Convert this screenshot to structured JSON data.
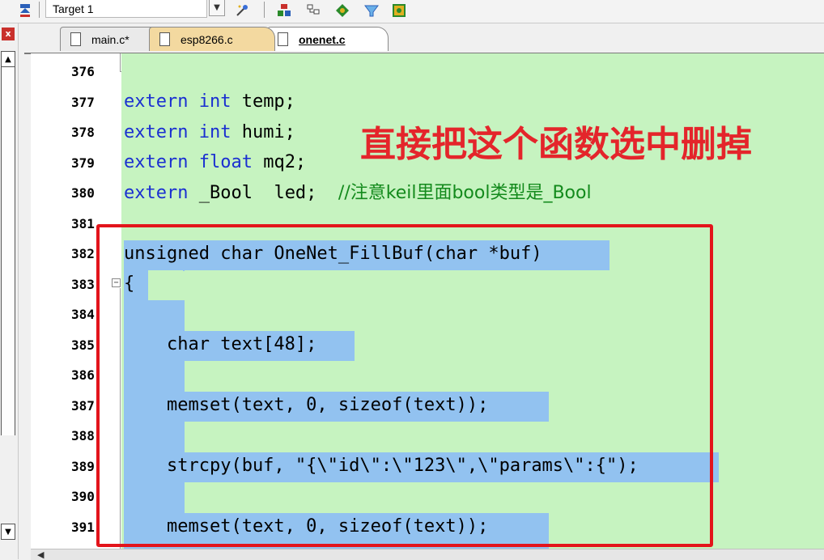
{
  "toolbar": {
    "target_label": "Target 1"
  },
  "tabs": [
    {
      "label": "main.c*",
      "active": false
    },
    {
      "label": "esp8266.c",
      "active": false
    },
    {
      "label": "onenet.c",
      "active": true
    }
  ],
  "editor": {
    "line_numbers": [
      "376",
      "377",
      "378",
      "379",
      "380",
      "381",
      "382",
      "383",
      "384",
      "385",
      "386",
      "387",
      "388",
      "389",
      "390",
      "391"
    ],
    "lines": {
      "l377_kw": "extern int",
      "l377_rest": " temp;",
      "l378_kw": "extern int",
      "l378_rest": " humi;",
      "l379_kw": "extern float",
      "l379_rest": " mq2;",
      "l380_kw": "extern",
      "l380_rest": " _Bool  led;  ",
      "l380_comment": "//注意keil里面bool类型是_Bool",
      "l382": "unsigned char OneNet_FillBuf(char *buf)",
      "l383": "{",
      "l385": "    char text[48];",
      "l387": "    memset(text, 0, sizeof(text));",
      "l389": "    strcpy(buf, \"{\\\"id\\\":\\\"123\\\",\\\"params\\\":{\");",
      "l391": "    memset(text, 0, sizeof(text));"
    }
  },
  "annotation": {
    "text": "直接把这个函数选中删掉",
    "color": "#e4252b"
  },
  "colors": {
    "code_background": "#c6f3c0",
    "selection": "#92c2f0",
    "keyword": "#1a2fd1",
    "comment": "#138a1c",
    "highlight_box": "#e3141b"
  }
}
